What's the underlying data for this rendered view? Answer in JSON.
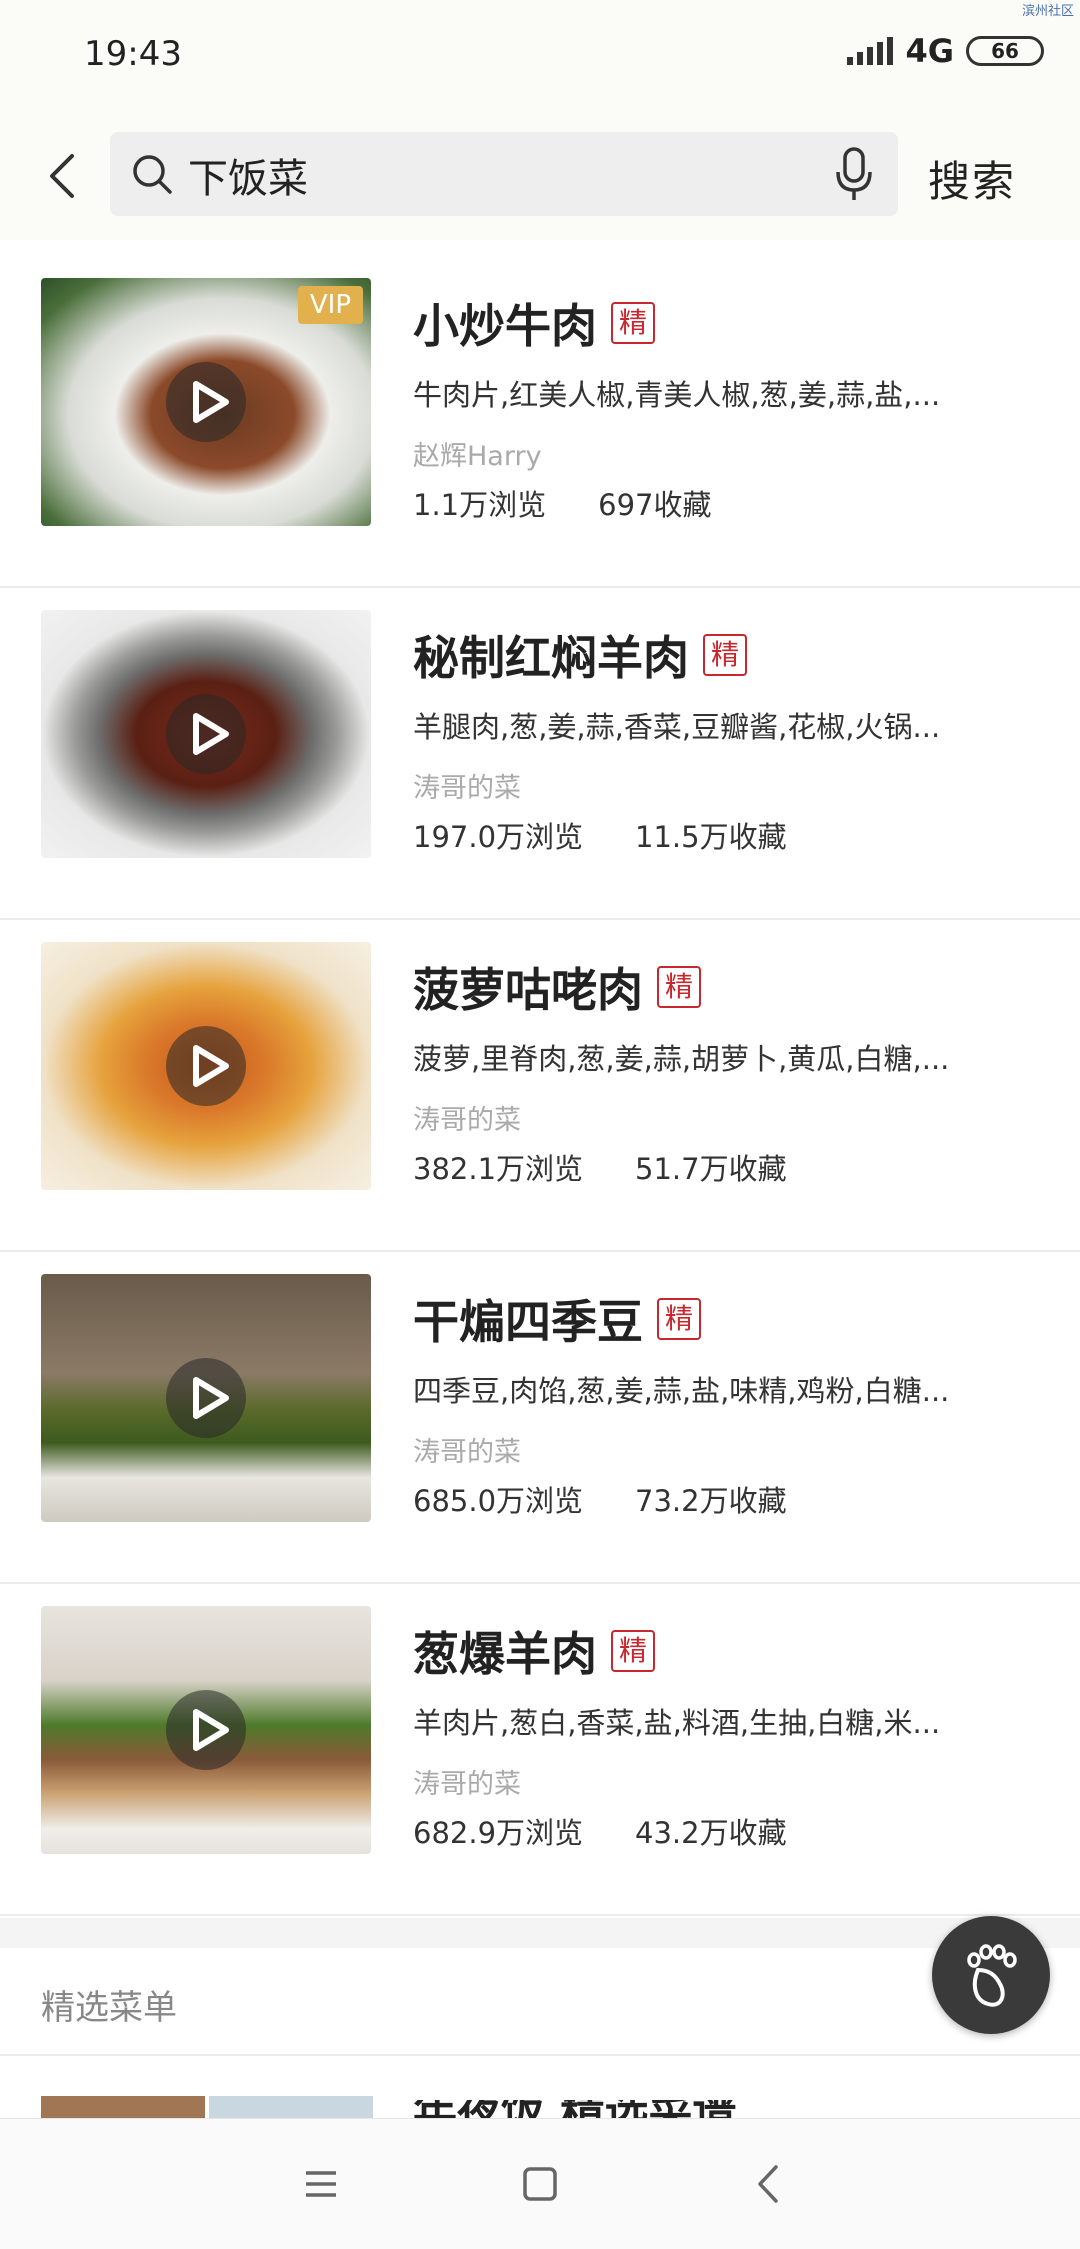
{
  "status": {
    "time": "19:43",
    "network": "4G",
    "battery": "66",
    "watermark": "滨州社区"
  },
  "search": {
    "query": "下饭菜",
    "button_label": "搜索"
  },
  "recipes": [
    {
      "title": "小炒牛肉",
      "badge": "精",
      "vip": "VIP",
      "ingredients": "牛肉片,红美人椒,青美人椒,葱,姜,蒜,盐,...",
      "author": "赵辉Harry",
      "views": "1.1万浏览",
      "favorites": "697收藏"
    },
    {
      "title": "秘制红焖羊肉",
      "badge": "精",
      "ingredients": "羊腿肉,葱,姜,蒜,香菜,豆瓣酱,花椒,火锅...",
      "author": "涛哥的菜",
      "views": "197.0万浏览",
      "favorites": "11.5万收藏"
    },
    {
      "title": "菠萝咕咾肉",
      "badge": "精",
      "ingredients": "菠萝,里脊肉,葱,姜,蒜,胡萝卜,黄瓜,白糖,...",
      "author": "涛哥的菜",
      "views": "382.1万浏览",
      "favorites": "51.7万收藏"
    },
    {
      "title": "干煸四季豆",
      "badge": "精",
      "ingredients": "四季豆,肉馅,葱,姜,蒜,盐,味精,鸡粉,白糖...",
      "author": "涛哥的菜",
      "views": "685.0万浏览",
      "favorites": "73.2万收藏"
    },
    {
      "title": "葱爆羊肉",
      "badge": "精",
      "ingredients": "羊肉片,葱白,香菜,盐,料酒,生抽,白糖,米...",
      "author": "涛哥的菜",
      "views": "682.9万浏览",
      "favorites": "43.2万收藏"
    }
  ],
  "section": {
    "title": "精选菜单",
    "peek_title": "年夜饭 精选菜谱"
  }
}
